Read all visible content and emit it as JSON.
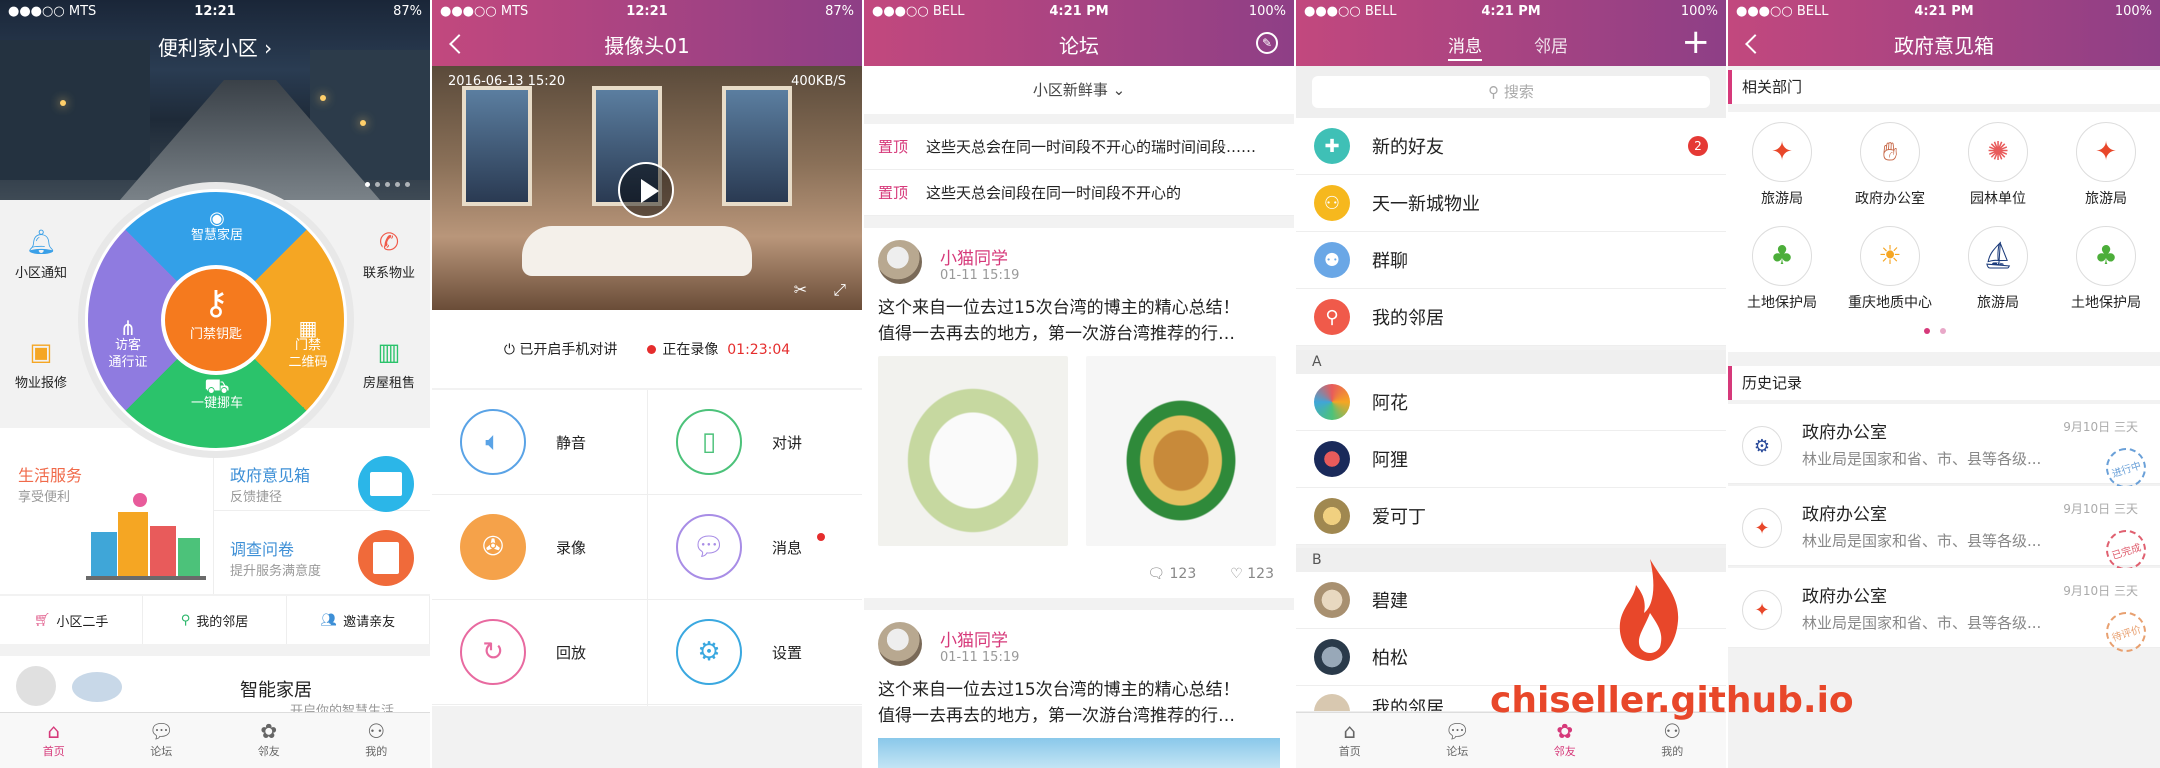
{
  "status_bars": [
    {
      "carrier": "●●●○○ MTS",
      "time": "12:21",
      "battery": "87%"
    },
    {
      "carrier": "●●●○○ MTS",
      "time": "12:21",
      "battery": "87%"
    },
    {
      "carrier": "●●●○○ BELL",
      "time": "4:21 PM",
      "battery": "100%"
    },
    {
      "carrier": "●●●○○ BELL",
      "time": "4:21 PM",
      "battery": "100%"
    },
    {
      "carrier": "●●●○○ BELL",
      "time": "4:21 PM",
      "battery": "100%"
    }
  ],
  "home": {
    "title": "便利家小区 ›",
    "wheel": {
      "top": "智慧家居",
      "left": "访客\n通行证",
      "right": "门禁\n二维码",
      "bottom": "一键挪车",
      "center": "门禁钥匙"
    },
    "side": {
      "notice": "小区通知",
      "repair": "物业报修",
      "contact": "联系物业",
      "rent": "房屋租售"
    },
    "life_title": "生活服务",
    "life_sub": "享受便利",
    "gov_title": "政府意见箱",
    "gov_sub": "反馈捷径",
    "survey_title": "调查问卷",
    "survey_sub": "提升服务满意度",
    "quick": [
      "小区二手",
      "我的邻居",
      "邀请亲友"
    ],
    "smart_title": "智能家居",
    "smart_sub": "开启你的智慧生活",
    "tabs": [
      "首页",
      "论坛",
      "邻友",
      "我的"
    ]
  },
  "camera": {
    "title": "摄像头01",
    "timestamp": "2016-06-13 15:20",
    "bitrate": "400KB/S",
    "intercom": "已开启手机对讲",
    "recording": "正在录像",
    "rec_time": "01:23:04",
    "controls": [
      "静音",
      "对讲",
      "录像",
      "消息",
      "回放",
      "设置"
    ]
  },
  "forum": {
    "title": "论坛",
    "filter": "小区新鲜事 ⌄",
    "pin_label": "置顶",
    "pins": [
      "这些天总会在同一时间段不开心的瑞时间间段……",
      "这些天总会间段在同一时间段不开心的"
    ],
    "posts": [
      {
        "user": "小猫同学",
        "date": "01-11 15:19",
        "line1": "这个来自一位去过15次台湾的博主的精心总结！",
        "line2": "值得一去再去的地方，第一次游台湾推荐的行…",
        "comments": "123",
        "likes": "123"
      },
      {
        "user": "小猫同学",
        "date": "01-11 15:19",
        "line1": "这个来自一位去过15次台湾的博主的精心总结！",
        "line2": "值得一去再去的地方，第一次游台湾推荐的行…"
      }
    ]
  },
  "neighbors": {
    "tab_msg": "消息",
    "tab_nb": "邻居",
    "search": "搜索",
    "top": [
      {
        "name": "新的好友",
        "badge": "2",
        "color": "#3fc0b6"
      },
      {
        "name": "天一新城物业",
        "color": "#f6b81e"
      },
      {
        "name": "群聊",
        "color": "#6aa7e6"
      },
      {
        "name": "我的邻居",
        "color": "#f05a4a"
      }
    ],
    "group_a": "A",
    "a": [
      "阿花",
      "阿狸",
      "爱可丁"
    ],
    "group_b": "B",
    "b": [
      "碧建",
      "柏松",
      "我的邻居"
    ],
    "tabs": [
      "首页",
      "论坛",
      "邻友",
      "我的"
    ]
  },
  "gov": {
    "title": "政府意见箱",
    "dept_header": "相关部门",
    "depts": [
      "旅游局",
      "政府办公室",
      "园林单位",
      "旅游局",
      "土地保护局",
      "重庆地质中心",
      "旅游局",
      "土地保护局"
    ],
    "history_header": "历史记录",
    "history": [
      {
        "title": "政府办公室",
        "sub": "林业局是国家和省、市、县等各级...",
        "date": "9月10日 三天",
        "stamp": "进行中",
        "stamp_color": "#6aa0d8"
      },
      {
        "title": "政府办公室",
        "sub": "林业局是国家和省、市、县等各级...",
        "date": "9月10日 三天",
        "stamp": "已完成",
        "stamp_color": "#e06070"
      },
      {
        "title": "政府办公室",
        "sub": "林业局是国家和省、市、县等各级...",
        "date": "9月10日 三天",
        "stamp": "待评价",
        "stamp_color": "#e8a070"
      }
    ]
  },
  "watermark": "chiseller.github.io"
}
